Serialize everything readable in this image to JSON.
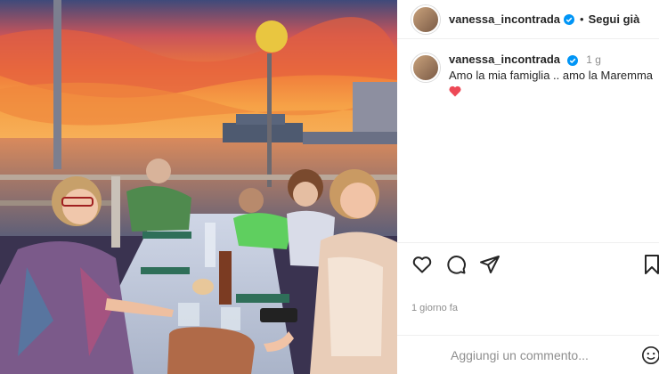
{
  "post": {
    "username": "vanessa_incontrada",
    "follow_label": "Segui già",
    "separator": "•",
    "caption": {
      "username": "vanessa_incontrada",
      "age": "1 g",
      "text": "Amo la mia famiglia .. amo la Maremma",
      "emoji": "heart-emoji"
    },
    "date": "1 giorno fa",
    "comment_placeholder": "Aggiungi un commento...",
    "actions": [
      "heart-icon",
      "comment-icon",
      "share-icon",
      "bookmark-icon"
    ]
  },
  "colors": {
    "verified": "#0095f6",
    "heart_emoji": "#ed4956",
    "muted_text": "#8e8e8e"
  }
}
